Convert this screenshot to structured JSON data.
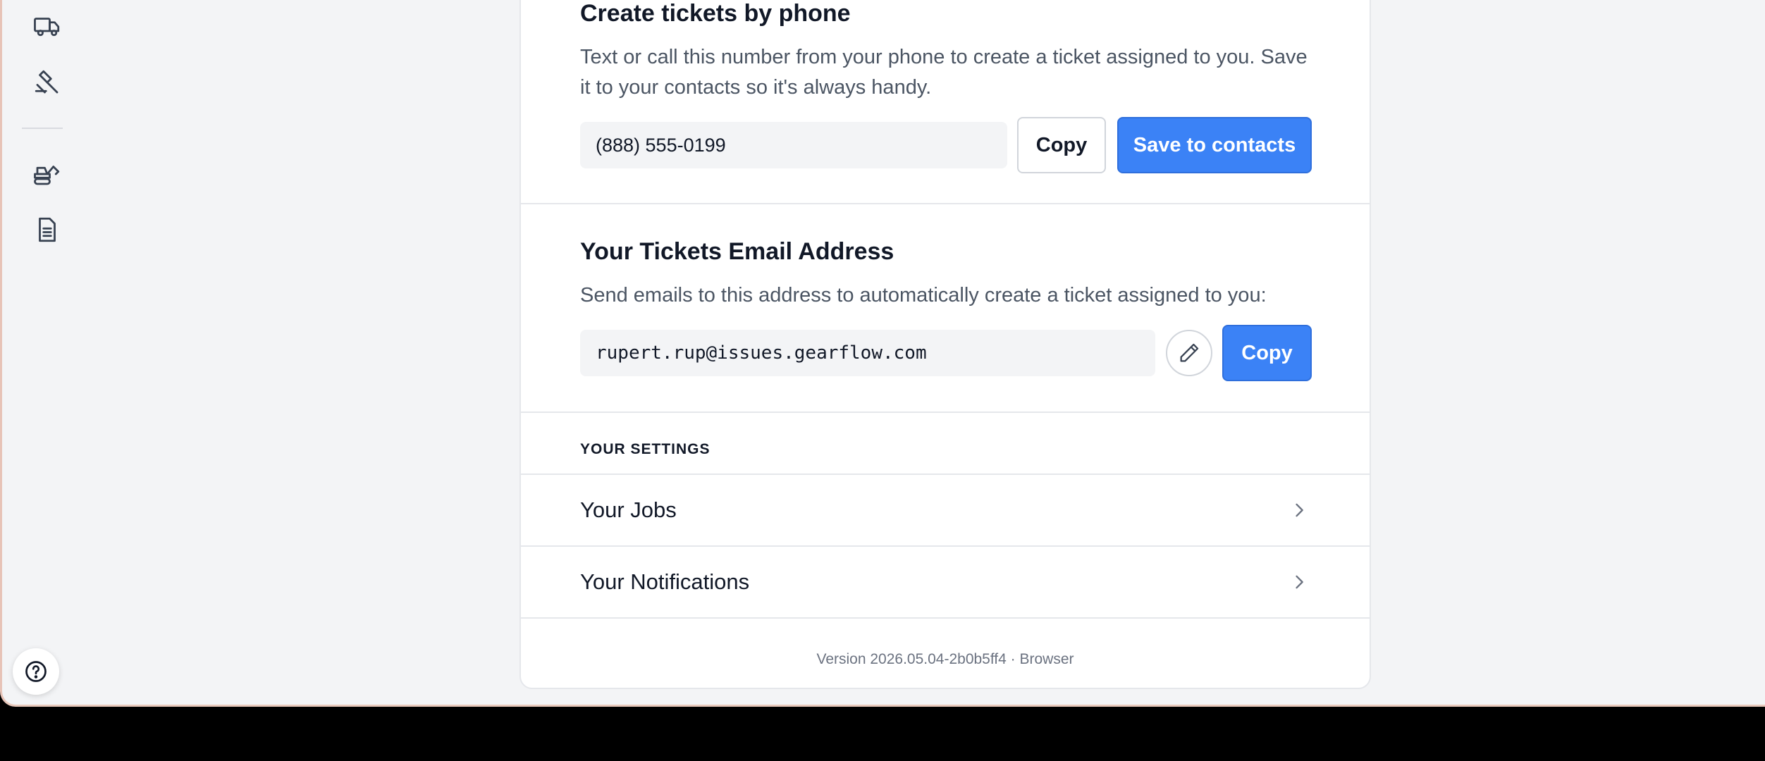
{
  "sidebar": {
    "icons": [
      "truck-icon",
      "hammer-icon",
      "excavator-icon",
      "document-icon"
    ],
    "help_icon": "help-circle-icon"
  },
  "phone_section": {
    "title": "Create tickets by phone",
    "description": "Text or call this number from your phone to create a ticket assigned to you. Save it to your contacts so it's always handy.",
    "phone_number": "(888) 555-0199",
    "copy_label": "Copy",
    "save_label": "Save to contacts"
  },
  "email_section": {
    "title": "Your Tickets Email Address",
    "description": "Send emails to this address to automatically create a ticket assigned to you:",
    "email": "rupert.rup@issues.gearflow.com",
    "edit_icon": "pencil-icon",
    "copy_label": "Copy"
  },
  "settings": {
    "header": "YOUR SETTINGS",
    "items": [
      {
        "label": "Your Jobs",
        "icon": "chevron-right-icon"
      },
      {
        "label": "Your Notifications",
        "icon": "chevron-right-icon"
      }
    ]
  },
  "footer": {
    "version": "Version 2026.05.04-2b0b5ff4 · Browser"
  },
  "colors": {
    "primary": "#3b82f6",
    "background": "#f3f4f6"
  }
}
